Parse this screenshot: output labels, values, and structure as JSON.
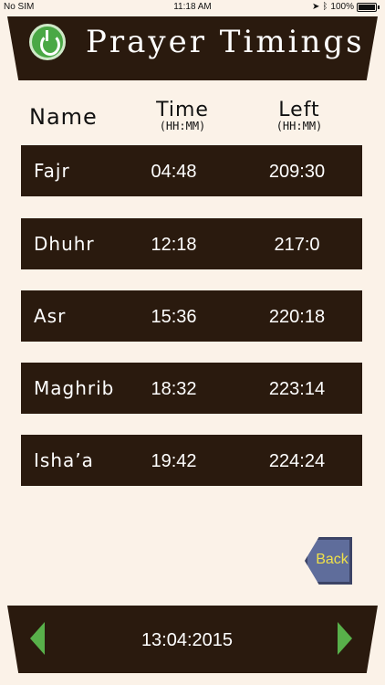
{
  "status_bar": {
    "carrier": "No SIM",
    "time": "11:18 AM",
    "battery": "100%"
  },
  "header": {
    "title": "Prayer Timings",
    "logo_icon": "app-logo-icon"
  },
  "columns": {
    "name": "Name",
    "time": "Time",
    "time_unit": "(HH:MM)",
    "left": "Left",
    "left_unit": "(HH:MM)"
  },
  "prayers": [
    {
      "name": "Fajr",
      "time": "04:48",
      "left": "209:30"
    },
    {
      "name": "Dhuhr",
      "time": "12:18",
      "left": "217:0"
    },
    {
      "name": "Asr",
      "time": "15:36",
      "left": "220:18"
    },
    {
      "name": "Maghrib",
      "time": "18:32",
      "left": "223:14"
    },
    {
      "name": "Isha’a",
      "time": "19:42",
      "left": "224:24"
    }
  ],
  "back_button": {
    "label": "Back"
  },
  "footer": {
    "date": "13:04:2015"
  },
  "colors": {
    "background": "#fbf2e8",
    "bar": "#2a1a0e",
    "accent_green": "#58b04a",
    "back_label": "#f0e14a"
  }
}
